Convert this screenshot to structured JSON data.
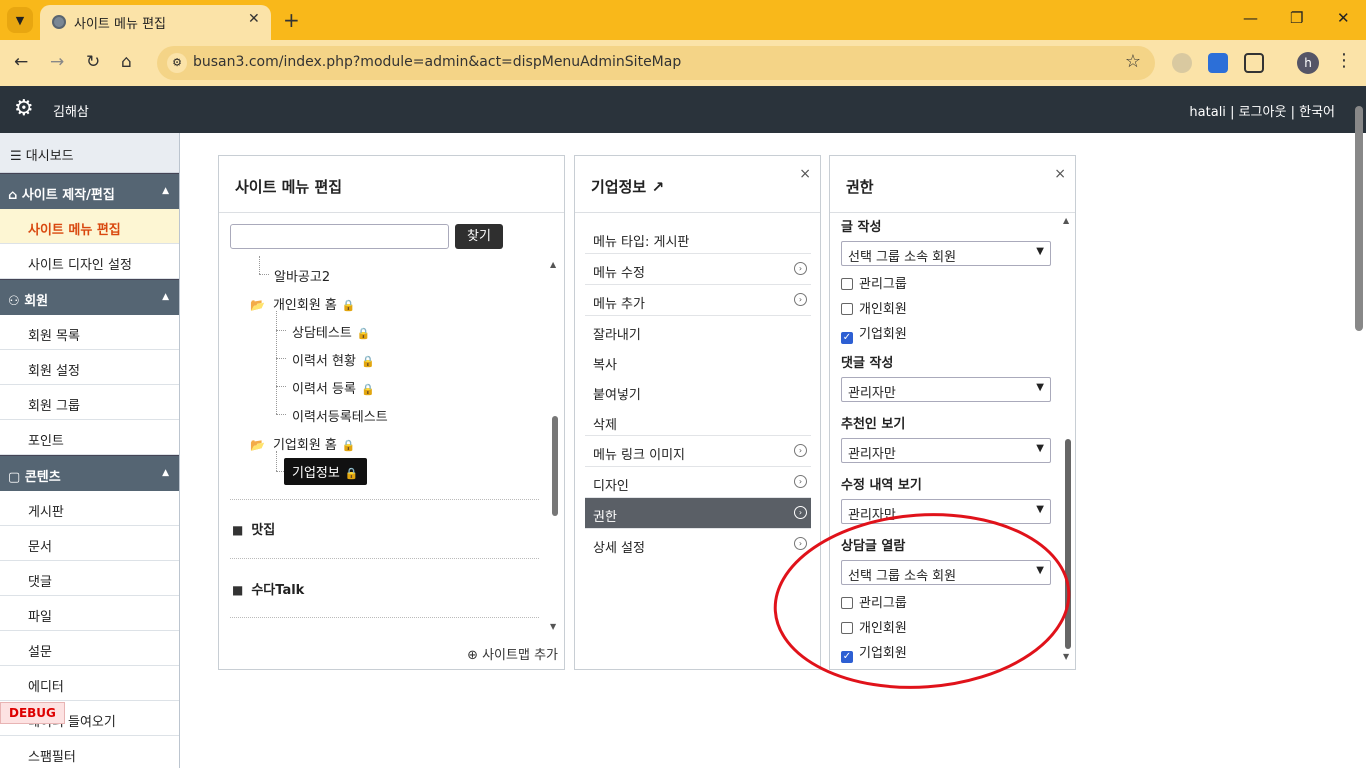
{
  "browser": {
    "tab_title": "사이트 메뉴 편집",
    "url": "busan3.com/index.php?module=admin&act=dispMenuAdminSiteMap",
    "profile_initial": "h"
  },
  "admin": {
    "site_name": "김해삼",
    "user": "hatali",
    "logout": "로그아웃",
    "language": "한국어",
    "sep": "|"
  },
  "sidebar": {
    "dashboard": "대시보드",
    "sections": [
      {
        "label": "사이트 제작/편집",
        "items": [
          "사이트 메뉴 편집",
          "사이트 디자인 설정"
        ]
      },
      {
        "label": "회원",
        "items": [
          "회원 목록",
          "회원 설정",
          "회원 그룹",
          "포인트"
        ]
      },
      {
        "label": "콘텐츠",
        "items": [
          "게시판",
          "문서",
          "댓글",
          "파일",
          "설문",
          "에디터",
          "데이터 들여오기",
          "스팸필터"
        ]
      }
    ],
    "debug": "DEBUG"
  },
  "sitemap_panel": {
    "title": "사이트 메뉴 편집",
    "search_button": "찾기",
    "search_value": "",
    "tree": {
      "n1": "알바공고2",
      "n2": "개인회원 홈",
      "n3": "상담테스트",
      "n4": "이력서 현황",
      "n5": "이력서 등록",
      "n6": "이력서등록테스트",
      "n7": "기업회원 홈",
      "n8": "기업정보"
    },
    "sitemaps": [
      "맛집",
      "수다Talk"
    ],
    "add_sitemap": "사이트맵 추가"
  },
  "menu_panel": {
    "title": "기업정보",
    "type": "메뉴 타입: 게시판",
    "items": [
      {
        "label": "메뉴 수정",
        "arrow": true
      },
      {
        "label": "메뉴 추가",
        "arrow": true
      },
      {
        "label": "잘라내기",
        "arrow": false
      },
      {
        "label": "복사",
        "arrow": false
      },
      {
        "label": "붙여넣기",
        "arrow": false
      },
      {
        "label": "삭제",
        "arrow": false
      },
      {
        "label": "메뉴 링크 이미지",
        "arrow": true
      },
      {
        "label": "디자인",
        "arrow": true
      },
      {
        "label": "권한",
        "arrow": true,
        "active": true
      },
      {
        "label": "상세 설정",
        "arrow": true
      }
    ],
    "close": "×"
  },
  "permission_panel": {
    "title": "권한",
    "close": "×",
    "write": {
      "label": "글 작성",
      "select": "선택 그룹 소속 회원",
      "groups": [
        "관리그룹",
        "개인회원",
        "기업회원"
      ],
      "checked": [
        false,
        false,
        true
      ]
    },
    "comment": {
      "label": "댓글 작성",
      "select": "관리자만"
    },
    "recommend": {
      "label": "추천인 보기",
      "select": "관리자만"
    },
    "history": {
      "label": "수정 내역 보기",
      "select": "관리자만"
    },
    "consult": {
      "label": "상담글 열람",
      "select": "선택 그룹 소속 회원",
      "groups": [
        "관리그룹",
        "개인회원",
        "기업회원"
      ],
      "checked": [
        false,
        false,
        true
      ]
    }
  },
  "colors": {
    "browser_frame": "#f9b81a",
    "admin_header": "#2a333b",
    "sidebar_section": "#556573",
    "active_menu_text": "#d9480f",
    "annotation": "#e0121a"
  }
}
